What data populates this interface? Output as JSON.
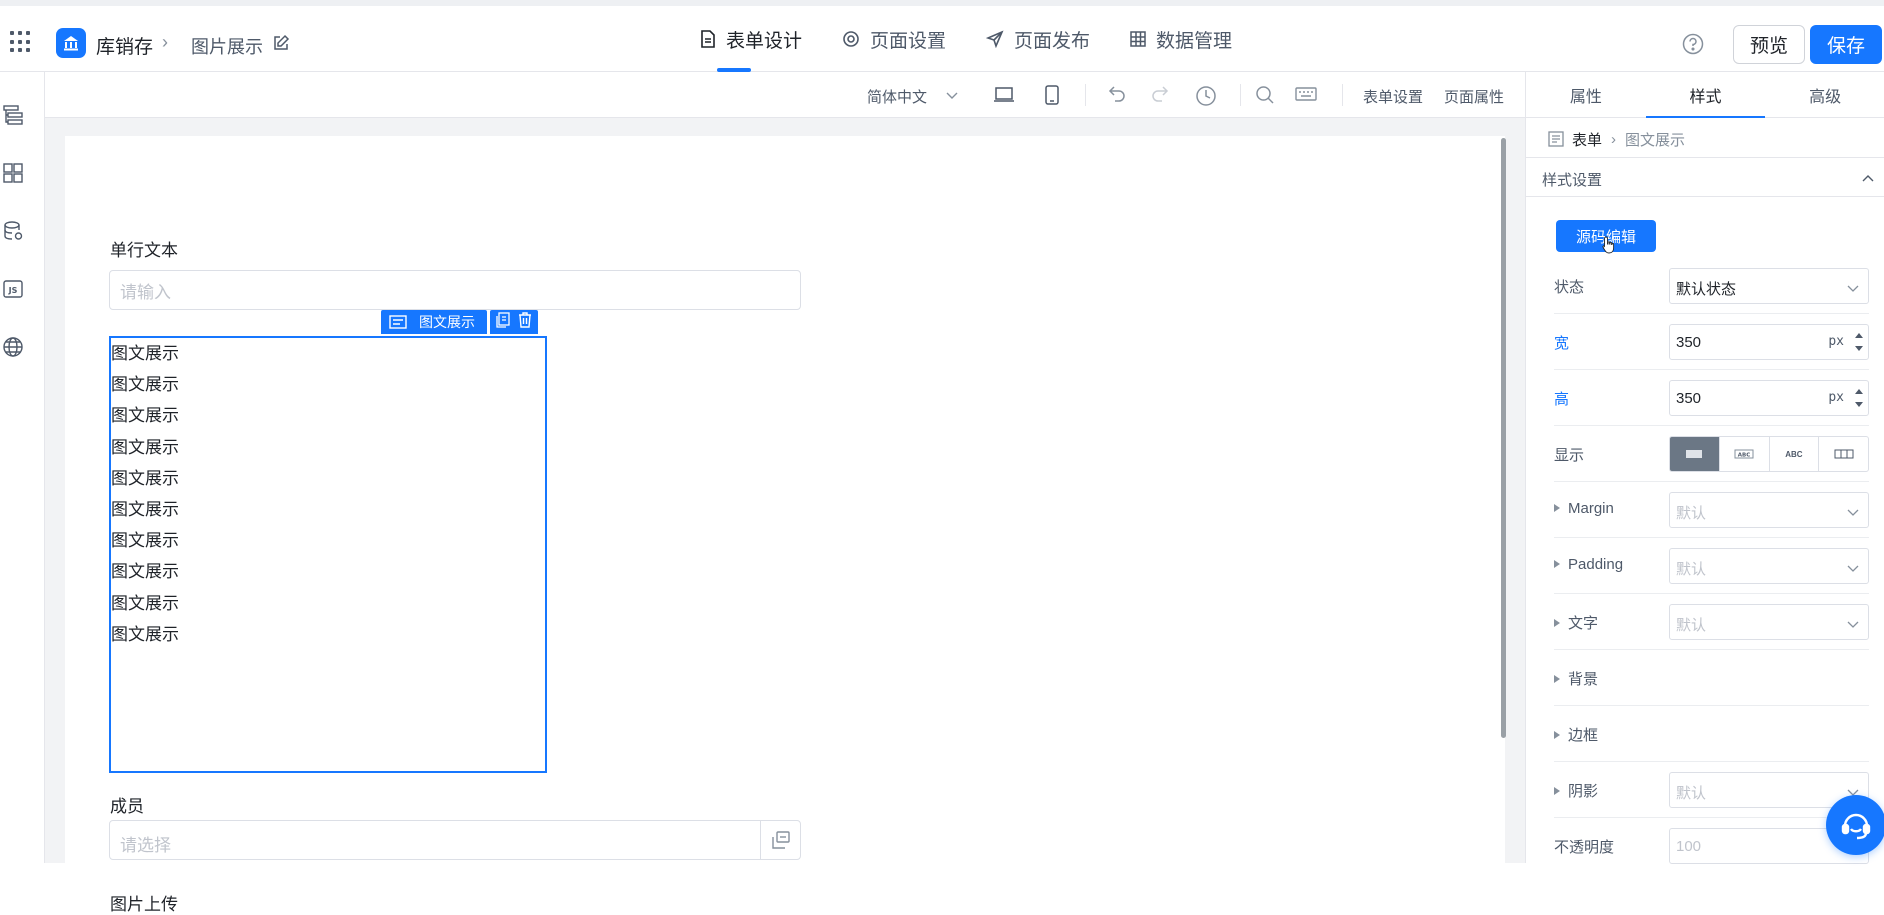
{
  "header": {
    "app_name": "库销存",
    "page_name": "图片展示",
    "tabs": [
      {
        "label": "表单设计",
        "icon": "document-icon"
      },
      {
        "label": "页面设置",
        "icon": "gear-icon"
      },
      {
        "label": "页面发布",
        "icon": "send-icon"
      },
      {
        "label": "数据管理",
        "icon": "table-icon"
      }
    ],
    "preview_label": "预览",
    "save_label": "保存"
  },
  "toolbar": {
    "language": "简体中文",
    "form_settings": "表单设置",
    "page_props": "页面属性"
  },
  "canvas": {
    "field1_label": "单行文本",
    "field1_placeholder": "请输入",
    "selected_tag": "图文展示",
    "text_lines": [
      "图文展示",
      "图文展示",
      "图文展示",
      "图文展示",
      "图文展示",
      "图文展示",
      "图文展示",
      "图文展示",
      "图文展示",
      "图文展示"
    ],
    "member_label": "成员",
    "member_placeholder": "请选择",
    "upload_label": "图片上传"
  },
  "panel": {
    "tabs": [
      "属性",
      "样式",
      "高级"
    ],
    "active_tab": "样式",
    "crumb_root": "表单",
    "crumb_current": "图文展示",
    "section_title": "样式设置",
    "source_edit": "源码编辑",
    "state_label": "状态",
    "state_value": "默认状态",
    "width_label": "宽",
    "width_value": "350",
    "height_label": "高",
    "height_value": "350",
    "unit": "px",
    "display_label": "显示",
    "display_options": [
      "block",
      "ABC",
      "ABC",
      "flex"
    ],
    "margin_label": "Margin",
    "padding_label": "Padding",
    "text_label": "文字",
    "default_ph": "默认",
    "bg_label": "背景",
    "border_label": "边框",
    "shadow_label": "阴影",
    "opacity_label": "不透明度",
    "opacity_ph": "100"
  },
  "colors": {
    "accent": "#1677ff",
    "canvas_bg": "#f2f3f5"
  }
}
